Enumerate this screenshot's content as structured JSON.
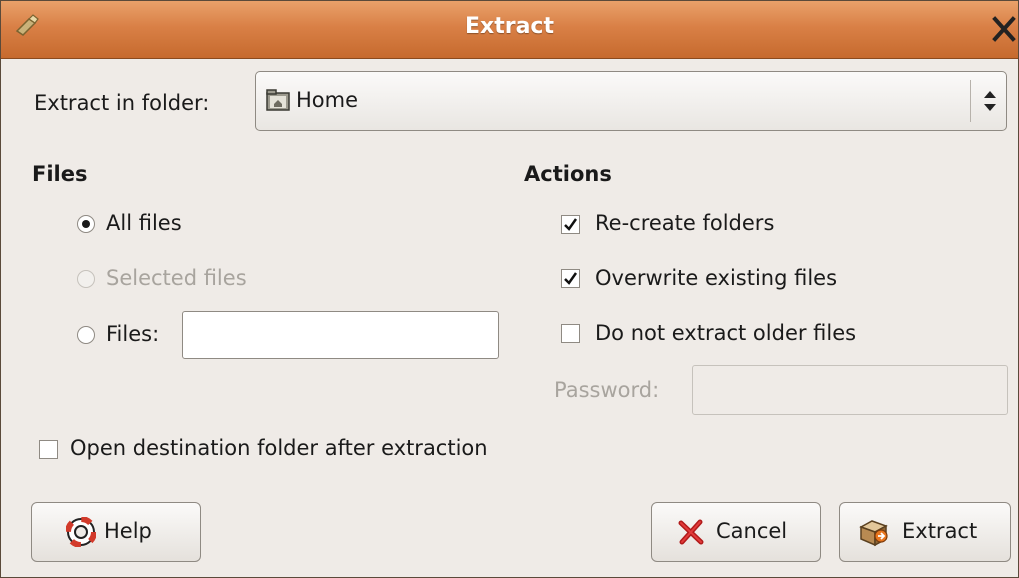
{
  "window": {
    "title": "Extract"
  },
  "destination": {
    "label": "Extract in folder:",
    "value": "Home"
  },
  "files": {
    "heading": "Files",
    "all_files": "All files",
    "selected_files": "Selected files",
    "files_label": "Files:",
    "files_value": ""
  },
  "actions": {
    "heading": "Actions",
    "recreate_folders": "Re-create folders",
    "overwrite_existing": "Overwrite existing files",
    "do_not_extract_older": "Do not extract older files",
    "password_label": "Password:",
    "password_value": ""
  },
  "open_destination": "Open destination folder after extraction",
  "buttons": {
    "help": "Help",
    "cancel": "Cancel",
    "extract": "Extract"
  },
  "state": {
    "selected_radio": "all_files",
    "recreate_folders_checked": true,
    "overwrite_existing_checked": true,
    "do_not_extract_older_checked": false,
    "open_destination_checked": false
  },
  "colors": {
    "titlebar": "#d98046",
    "background": "#efebe7"
  },
  "icons": [
    "app-icon",
    "close-icon",
    "folder-home-icon",
    "combo-arrows-icon",
    "help-icon",
    "cancel-icon",
    "extract-icon"
  ]
}
